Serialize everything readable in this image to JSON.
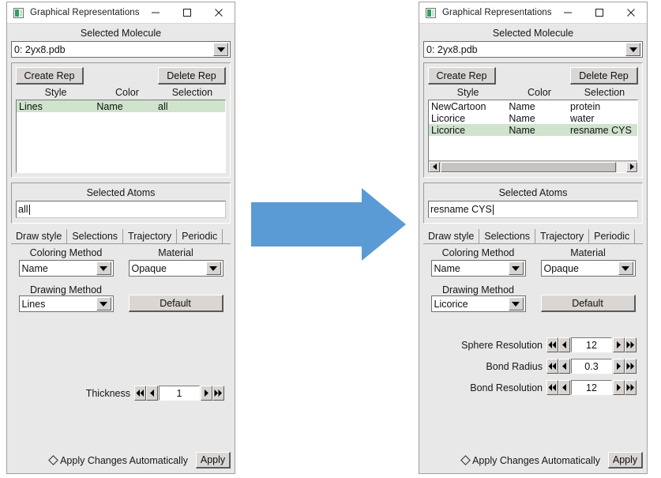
{
  "window": {
    "title": "Graphical Representations",
    "icon": "app-icon",
    "minimize": "–",
    "maximize": "☐",
    "close": "✕"
  },
  "labels": {
    "selected_molecule": "Selected Molecule",
    "selected_atoms": "Selected Atoms",
    "coloring_method": "Coloring Method",
    "material": "Material",
    "drawing_method": "Drawing Method",
    "default_button": "Default",
    "create_rep": "Create Rep",
    "delete_rep": "Delete Rep",
    "apply_auto": "Apply Changes Automatically",
    "apply": "Apply"
  },
  "table_headers": {
    "style": "Style",
    "color": "Color",
    "selection": "Selection"
  },
  "tabs": [
    {
      "label": "Draw style",
      "active": true
    },
    {
      "label": "Selections",
      "active": false
    },
    {
      "label": "Trajectory",
      "active": false
    },
    {
      "label": "Periodic",
      "active": false
    }
  ],
  "colors": {
    "arrow_blue": "#5B9BD5",
    "row_selected": "#CFE3CD",
    "panel_bg": "#E8E8E8",
    "field_bg": "#FFFFFF",
    "icon_green": "#2F9E62"
  },
  "left_panel": {
    "molecule": "0: 2yx8.pdb",
    "reps": [
      {
        "style": "Lines",
        "color": "Name",
        "selection": "all",
        "selected": true
      }
    ],
    "selected_atoms_value": "all",
    "coloring_method": "Name",
    "material": "Opaque",
    "drawing_method": "Lines",
    "spinners": [
      {
        "label": "Thickness",
        "value": "1"
      }
    ]
  },
  "right_panel": {
    "molecule": "0: 2yx8.pdb",
    "reps": [
      {
        "style": "NewCartoon",
        "color": "Name",
        "selection": "protein",
        "selected": false
      },
      {
        "style": "Licorice",
        "color": "Name",
        "selection": "water",
        "selected": false
      },
      {
        "style": "Licorice",
        "color": "Name",
        "selection": "resname CYS",
        "selected": true
      }
    ],
    "selected_atoms_value": "resname CYS",
    "coloring_method": "Name",
    "material": "Opaque",
    "drawing_method": "Licorice",
    "spinners": [
      {
        "label": "Sphere Resolution",
        "value": "12"
      },
      {
        "label": "Bond Radius",
        "value": "0.3"
      },
      {
        "label": "Bond Resolution",
        "value": "12"
      }
    ]
  }
}
